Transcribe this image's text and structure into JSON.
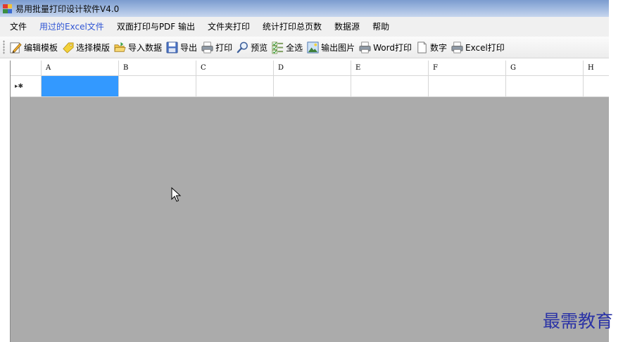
{
  "window": {
    "title": "易用批量打印设计软件V4.0"
  },
  "menu": [
    {
      "label": "文件"
    },
    {
      "label": "用过的Excel文件",
      "highlight": true
    },
    {
      "label": "双面打印与PDF 输出"
    },
    {
      "label": "文件夹打印"
    },
    {
      "label": "统计打印总页数"
    },
    {
      "label": "数据源"
    },
    {
      "label": "帮助"
    }
  ],
  "toolbar": {
    "edit_template": "编辑模板",
    "select_template": "选择模版",
    "import_data": "导入数据",
    "export": "导出",
    "print": "打印",
    "preview": "预览",
    "select_all": "全选",
    "export_image": "输出图片",
    "word_print": "Word打印",
    "number": "数字",
    "excel_print": "Excel打印"
  },
  "grid": {
    "columns": [
      "A",
      "B",
      "C",
      "D",
      "E",
      "F",
      "G",
      "H"
    ],
    "new_row_marker": "▸✱",
    "selected_cell": "A1"
  },
  "watermark": "最需教育",
  "colors": {
    "selection": "#3399ff",
    "empty_area": "#ababab",
    "watermark": "#2b33a6"
  }
}
